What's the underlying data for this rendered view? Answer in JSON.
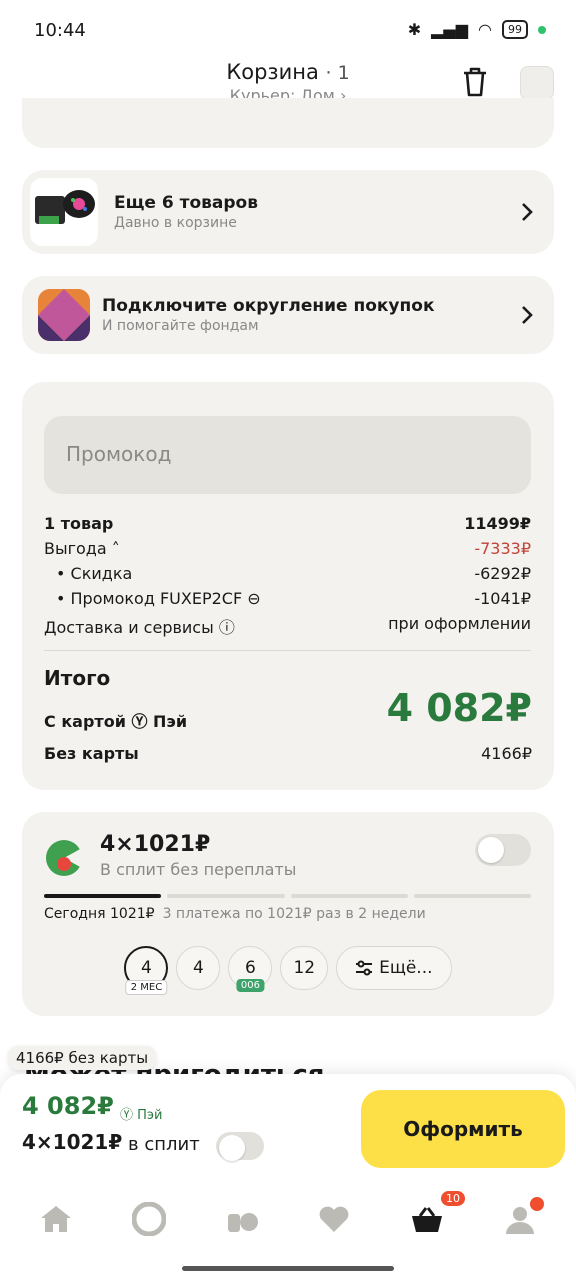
{
  "status_bar": {
    "time": "10:44",
    "battery": "99"
  },
  "header": {
    "title": "Корзина",
    "count": "· 1",
    "subtitle": "Курьер: Дом ›"
  },
  "more_items": {
    "title": "Еще 6 товаров",
    "subtitle": "Давно в корзине"
  },
  "rounding": {
    "title": "Подключите округление покупок",
    "subtitle": "И помогайте фондам"
  },
  "summary": {
    "promo_placeholder": "Промокод",
    "items_label": "1 товар",
    "items_value": "11499₽",
    "benefit_label": "Выгода ˄",
    "benefit_value": "-7333₽",
    "discount_label": "• Скидка",
    "discount_value": "-6292₽",
    "promo_label": "• Промокод FUXEP2CF ⊖",
    "promo_value": "-1041₽",
    "delivery_label": "Доставка и сервисы ⓘ",
    "delivery_value": "при оформлении",
    "total_title": "Итого",
    "with_card_label": "С картой Ⓨ Пэй",
    "with_card_value": "4 082₽",
    "no_card_label": "Без карты",
    "no_card_value": "4166₽"
  },
  "split": {
    "title": "4×1021₽",
    "subtitle": "В сплит без переплаты",
    "progress": [
      1,
      0,
      0,
      0
    ],
    "today": "Сегодня 1021₽",
    "schedule": "3 платежа по 1021₽ раз в 2 недели",
    "chips": [
      {
        "label": "4",
        "tag": "2 МЕС"
      },
      {
        "label": "4",
        "tag": ""
      },
      {
        "label": "6",
        "tag": "006"
      },
      {
        "label": "12",
        "tag": ""
      },
      {
        "label": "Ещё..."
      }
    ]
  },
  "maybe_useful": "Может пригодиться",
  "bottom": {
    "tip": "4166₽ без карты",
    "total": "4 082₽",
    "pay": "Ⓨ Пэй",
    "split": "4×1021₽",
    "split_label": "в сплит",
    "checkout": "Оформить"
  },
  "tabbar": {
    "cart_badge": "10"
  },
  "colors": {
    "accent_green": "#2b7a3d",
    "checkout_yellow": "#fde047",
    "negative_red": "#c3423a",
    "badge_red": "#f04f2f"
  },
  "icons": [
    "home-icon",
    "alice-icon",
    "catalog-icon",
    "favorites-icon",
    "cart-icon",
    "profile-icon",
    "trash-icon",
    "chevron-right-icon"
  ]
}
